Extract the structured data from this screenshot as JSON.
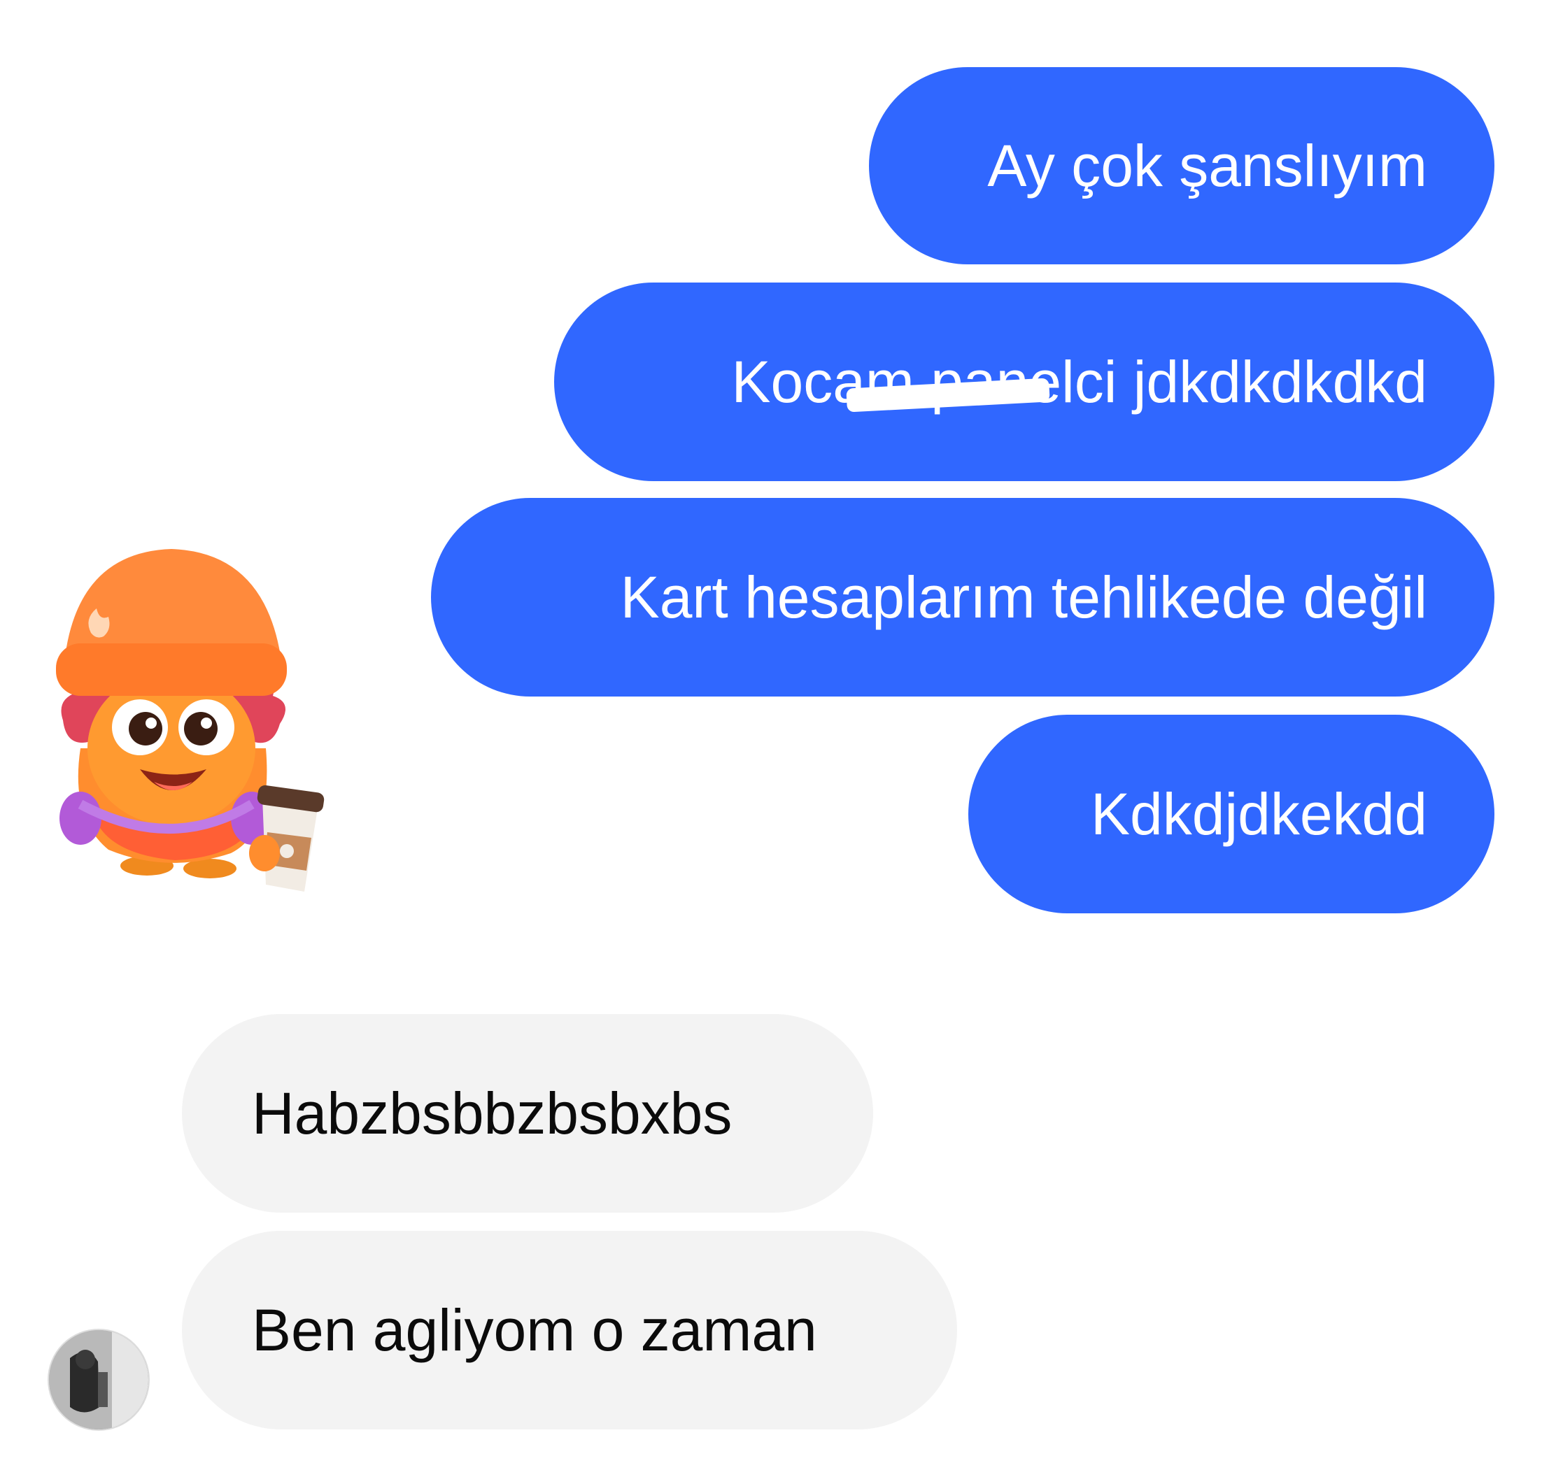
{
  "messages": {
    "sent": [
      {
        "text": "Ay çok şanslıyım"
      },
      {
        "text": "Kocam panelci jdkdkdkdkd"
      },
      {
        "text": "Kart hesaplarım tehlikede değil"
      },
      {
        "text": "Kdkdjdkekdd"
      }
    ],
    "received": [
      {
        "text": "Habzbsbbzbsbxbs"
      },
      {
        "text": "Ben agliyom o zaman"
      }
    ]
  },
  "colors": {
    "sent_bubble": "#3067ff",
    "received_bubble": "#f3f3f3",
    "sticker_primary": "#ff8a3c"
  },
  "icons": {
    "sticker": "orange-mascot-with-beanie-and-coffee",
    "avatar": "contact-avatar"
  }
}
